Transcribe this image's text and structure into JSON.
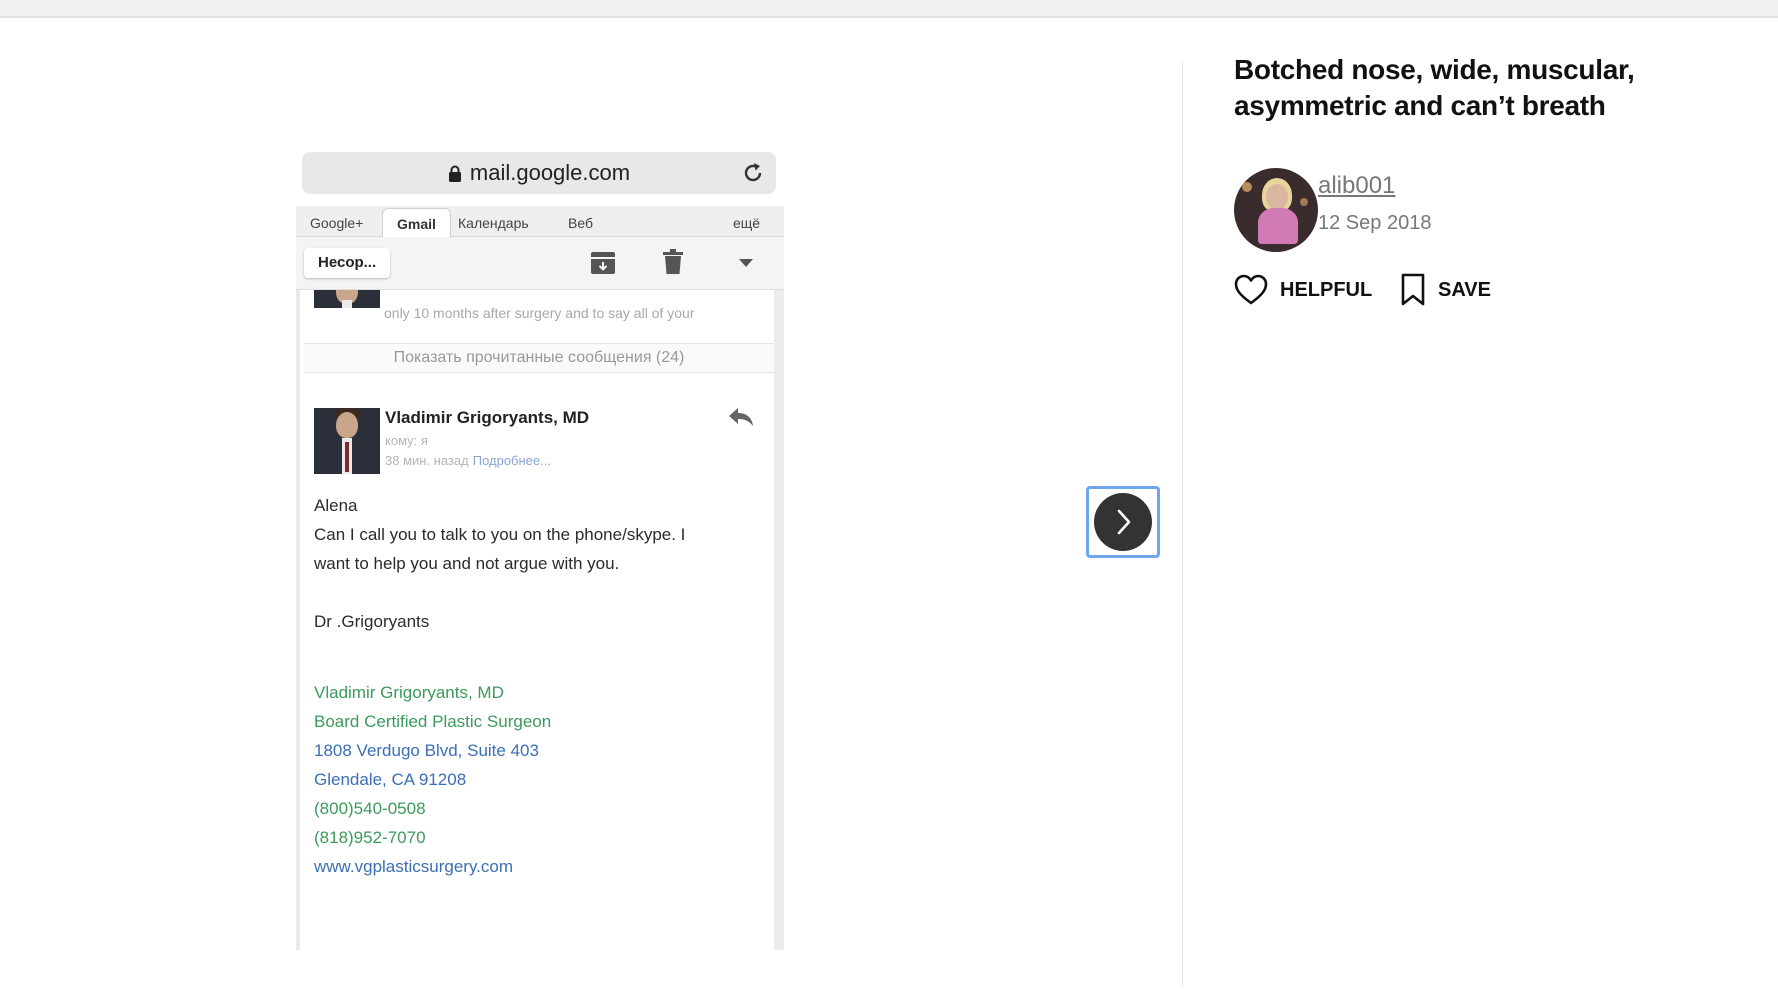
{
  "embedded_screenshot": {
    "url": "mail.google.com",
    "tabs": [
      "Google+",
      "Gmail",
      "Календарь",
      "Веб",
      "ещё"
    ],
    "inbox_button": "Несор...",
    "faded_preview": "only 10 months after surgery and to say all of your",
    "show_read": "Показать прочитанные сообщения (24)",
    "sender": "Vladimir Grigoryants, MD",
    "to": "кому: я",
    "time": "38 мин. назад",
    "time_more": "Подробнее...",
    "body": {
      "greeting": "Alena",
      "line1": "Can I call you to talk to you on the phone/skype.  I",
      "line2": "want to help you and not argue with you.",
      "signoff": "Dr .Grigoryants"
    },
    "signature": {
      "name": "Vladimir Grigoryants, MD",
      "title": "Board Certified Plastic Surgeon",
      "address1": "1808 Verdugo Blvd, Suite 403",
      "address2": "Glendale, CA  91208",
      "phone1": "(800)540-0508",
      "phone2": "(818)952-7070",
      "website": "www.vgplasticsurgery.com"
    }
  },
  "next_button": {
    "icon": "chevron-right-icon"
  },
  "post": {
    "title": "Botched nose, wide, muscular, asymmetric and can’t breath",
    "username": "alib001",
    "date": "12 Sep 2018",
    "helpful_label": "HELPFUL",
    "save_label": "SAVE"
  },
  "colors": {
    "accent_focus": "#6fa6f0",
    "next_button_bg": "#333333",
    "signature_green": "#3b9a5c",
    "signature_blue": "#3a6fb5"
  }
}
